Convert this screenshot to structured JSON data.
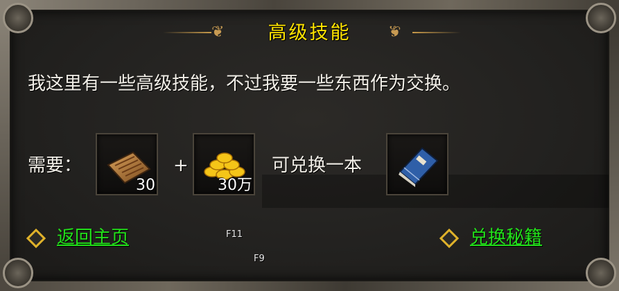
{
  "dialog": {
    "title": "高级技能",
    "description": "我这里有一些高级技能，不过我要一些东西作为交换。",
    "requirement_label": "需要：",
    "plus_sign": "+",
    "exchange_text": "可兑换一本",
    "items": [
      {
        "icon": "scroll-icon",
        "count": "30"
      },
      {
        "icon": "gold-coins-icon",
        "count": "30万"
      },
      {
        "icon": "skill-book-icon",
        "count": ""
      }
    ],
    "actions": {
      "back_label": "返回主页",
      "exchange_label": "兑换秘籍"
    },
    "hotkeys": [
      "F11",
      "F9"
    ]
  },
  "colors": {
    "title": "#ffe400",
    "link": "#22e01a",
    "text": "#f2efe8",
    "diamond": "#e0b22a"
  }
}
